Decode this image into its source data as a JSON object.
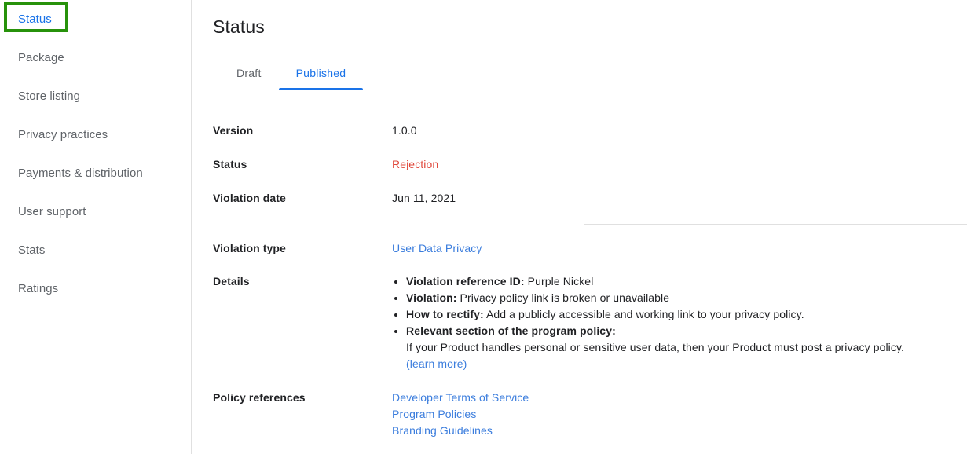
{
  "sidebar": {
    "items": [
      {
        "label": "Status",
        "active": true
      },
      {
        "label": "Package",
        "active": false
      },
      {
        "label": "Store listing",
        "active": false
      },
      {
        "label": "Privacy practices",
        "active": false
      },
      {
        "label": "Payments & distribution",
        "active": false
      },
      {
        "label": "User support",
        "active": false
      },
      {
        "label": "Stats",
        "active": false
      },
      {
        "label": "Ratings",
        "active": false
      }
    ],
    "highlight_color": "#27920b"
  },
  "main": {
    "title": "Status",
    "tabs": [
      {
        "label": "Draft",
        "active": false
      },
      {
        "label": "Published",
        "active": true
      }
    ],
    "accent_color": "#1a73e8",
    "rows": {
      "version": {
        "label": "Version",
        "value": "1.0.0"
      },
      "status": {
        "label": "Status",
        "value": "Rejection",
        "value_color": "#e0483b"
      },
      "violation_date": {
        "label": "Violation date",
        "value": "Jun 11, 2021"
      },
      "violation_type": {
        "label": "Violation type",
        "value": "User Data Privacy"
      },
      "details": {
        "label": "Details"
      },
      "policy_references": {
        "label": "Policy references"
      }
    },
    "details_bullets": [
      {
        "term": "Violation reference ID:",
        "text": " Purple Nickel"
      },
      {
        "term": "Violation:",
        "text": " Privacy policy link is broken or unavailable"
      },
      {
        "term": "How to rectify:",
        "text": " Add a publicly accessible and working link to your privacy policy."
      },
      {
        "term": "Relevant section of the program policy:",
        "text": ""
      }
    ],
    "details_sub_text": "If your Product handles personal or sensitive user data, then your Product must post a privacy policy.",
    "details_sub_link": "(learn more)",
    "policy_links": [
      "Developer Terms of Service",
      "Program Policies",
      "Branding Guidelines"
    ]
  }
}
